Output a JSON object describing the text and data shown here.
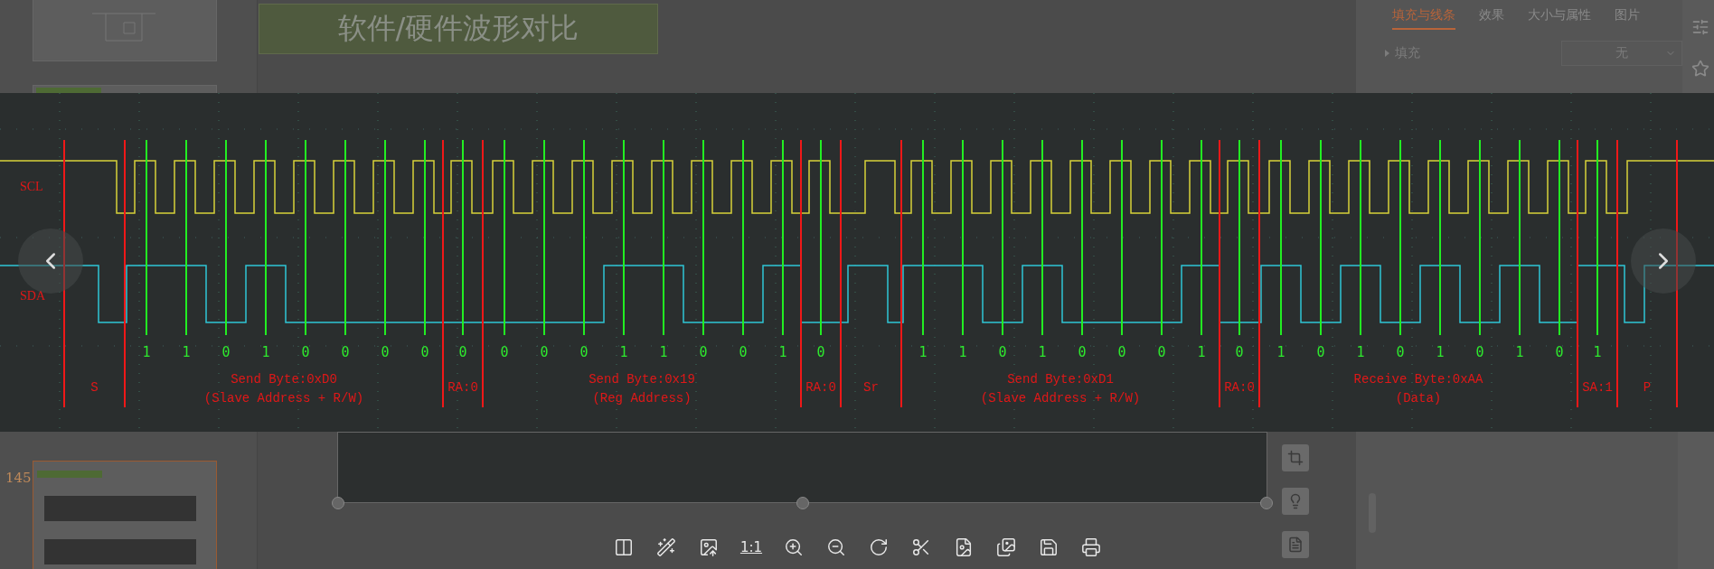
{
  "slide_title": "软件/硬件波形对比",
  "slide_number": "145",
  "format_panel": {
    "tabs": [
      {
        "label": "填充与线条",
        "selected": true
      },
      {
        "label": "效果",
        "selected": false
      },
      {
        "label": "大小与属性",
        "selected": false
      },
      {
        "label": "图片",
        "selected": false
      }
    ],
    "fill": {
      "label": "填充",
      "expanded": false,
      "value": "无"
    }
  },
  "waveform": {
    "signals": [
      {
        "name": "SCL"
      },
      {
        "name": "SDA"
      }
    ],
    "segments": [
      {
        "kind": "start",
        "label": "S"
      },
      {
        "kind": "byte",
        "label": "Send Byte:0xD0",
        "sublabel": "(Slave Address + R/W)",
        "bits": [
          {
            "value": "1"
          },
          {
            "value": "1"
          },
          {
            "value": "0"
          },
          {
            "value": "1"
          },
          {
            "value": "0"
          },
          {
            "value": "0"
          },
          {
            "value": "0"
          },
          {
            "value": "0"
          }
        ]
      },
      {
        "kind": "ack",
        "label": "RA:0",
        "bit": {
          "value": "0"
        }
      },
      {
        "kind": "byte",
        "label": "Send Byte:0x19",
        "sublabel": "(Reg Address)",
        "bits": [
          {
            "value": "0"
          },
          {
            "value": "0"
          },
          {
            "value": "0"
          },
          {
            "value": "1"
          },
          {
            "value": "1"
          },
          {
            "value": "0"
          },
          {
            "value": "0"
          },
          {
            "value": "1"
          }
        ]
      },
      {
        "kind": "ack",
        "label": "RA:0",
        "bit": {
          "value": "0"
        }
      },
      {
        "kind": "restart",
        "label": "Sr"
      },
      {
        "kind": "byte",
        "label": "Send Byte:0xD1",
        "sublabel": "(Slave Address + R/W)",
        "bits": [
          {
            "value": "1"
          },
          {
            "value": "1"
          },
          {
            "value": "0"
          },
          {
            "value": "1"
          },
          {
            "value": "0"
          },
          {
            "value": "0"
          },
          {
            "value": "0"
          },
          {
            "value": "1"
          }
        ]
      },
      {
        "kind": "ack",
        "label": "RA:0",
        "bit": {
          "value": "0"
        }
      },
      {
        "kind": "byte",
        "label": "Receive Byte:0xAA",
        "sublabel": "(Data)",
        "bits": [
          {
            "value": "1"
          },
          {
            "value": "0"
          },
          {
            "value": "1"
          },
          {
            "value": "0"
          },
          {
            "value": "1"
          },
          {
            "value": "0"
          },
          {
            "value": "1"
          },
          {
            "value": "0"
          }
        ]
      },
      {
        "kind": "ack",
        "label": "SA:1",
        "bit": {
          "value": "1"
        }
      },
      {
        "kind": "stop",
        "label": "P"
      }
    ]
  },
  "viewer_toolbar": {
    "actual_size_label": "1:1"
  }
}
